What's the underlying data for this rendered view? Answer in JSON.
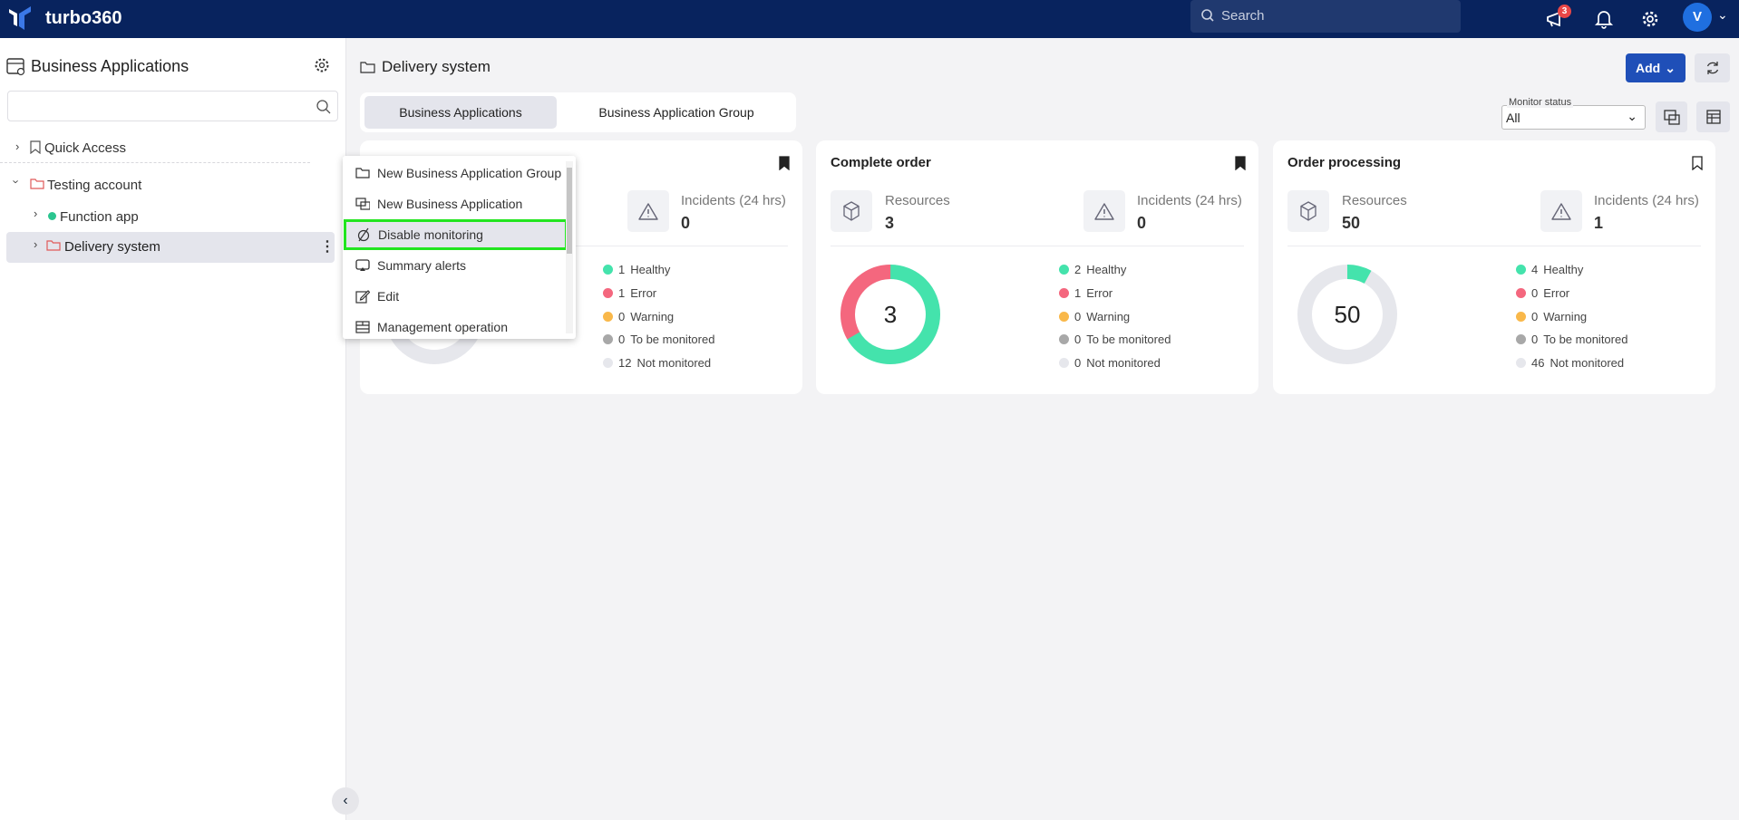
{
  "header": {
    "brand": "turbo360",
    "search_placeholder": "Search",
    "announcements_badge": "3",
    "avatar_initial": "V"
  },
  "sidebar": {
    "title": "Business Applications",
    "search_value": "",
    "tree": [
      {
        "label": "Quick Access"
      },
      {
        "label": "Testing account"
      },
      {
        "label": "Function app"
      },
      {
        "label": "Delivery system"
      }
    ]
  },
  "context_menu": {
    "items": [
      {
        "label": "New Business Application Group",
        "icon": "folder-icon"
      },
      {
        "label": "New Business Application",
        "icon": "app-icon"
      },
      {
        "label": "Disable monitoring",
        "icon": "disable-monitor-icon",
        "highlighted": true
      },
      {
        "label": "Summary alerts",
        "icon": "alert-monitor-icon"
      },
      {
        "label": "Edit",
        "icon": "edit-icon"
      },
      {
        "label": "Management operation",
        "icon": "management-icon"
      }
    ]
  },
  "main": {
    "title": "Delivery system",
    "tabs": [
      {
        "label": "Business Applications",
        "active": true
      },
      {
        "label": "Business Application Group"
      }
    ],
    "add_label": "Add",
    "monitor_status_label": "Monitor status",
    "monitor_status_value": "All"
  },
  "colors": {
    "healthy": "#44e3ac",
    "error": "#f4677e",
    "warning": "#f9b84a",
    "to_be_monitored": "#a8a8a8",
    "not_monitored": "#e6e7ec",
    "accent": "#1f4fb8",
    "header": "#08235e"
  },
  "labels": {
    "resources": "Resources",
    "incidents": "Incidents (24 hrs)",
    "healthy": "Healthy",
    "error": "Error",
    "warning": "Warning",
    "to_be_monitored": "To be monitored",
    "not_monitored": "Not monitored"
  },
  "cards": [
    {
      "title": "",
      "bookmarked": true,
      "resources": "",
      "incidents": "0",
      "center": "",
      "counts": {
        "healthy": 1,
        "error": 1,
        "warning": 0,
        "to_be_monitored": 0,
        "not_monitored": 12
      }
    },
    {
      "title": "Complete order",
      "bookmarked": true,
      "resources": "3",
      "incidents": "0",
      "center": "3",
      "counts": {
        "healthy": 2,
        "error": 1,
        "warning": 0,
        "to_be_monitored": 0,
        "not_monitored": 0
      }
    },
    {
      "title": "Order processing",
      "bookmarked": false,
      "resources": "50",
      "incidents": "1",
      "center": "50",
      "counts": {
        "healthy": 4,
        "error": 0,
        "warning": 0,
        "to_be_monitored": 0,
        "not_monitored": 46
      }
    }
  ]
}
